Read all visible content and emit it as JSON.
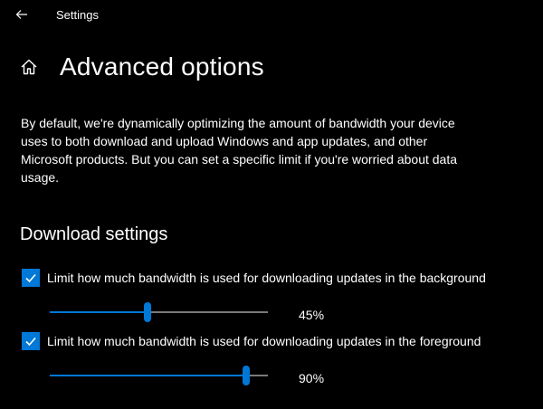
{
  "window": {
    "title": "Settings"
  },
  "page": {
    "title": "Advanced options"
  },
  "description": "By default, we're dynamically optimizing the amount of bandwidth your device uses to both download and upload Windows and app updates, and other Microsoft products. But you can set a specific limit if you're worried about data usage.",
  "download_settings": {
    "heading": "Download settings",
    "background": {
      "checked": true,
      "label": "Limit how much bandwidth is used for downloading updates in the background",
      "percent": 45,
      "value_text": "45%"
    },
    "foreground": {
      "checked": true,
      "label": "Limit how much bandwidth is used for downloading updates in the foreground",
      "percent": 90,
      "value_text": "90%"
    }
  },
  "colors": {
    "accent": "#0078d7",
    "background": "#000000",
    "text": "#ffffff",
    "track": "#7a7a7a"
  },
  "icons": {
    "back": "back-arrow-icon",
    "home": "home-icon",
    "check": "checkmark-icon"
  }
}
